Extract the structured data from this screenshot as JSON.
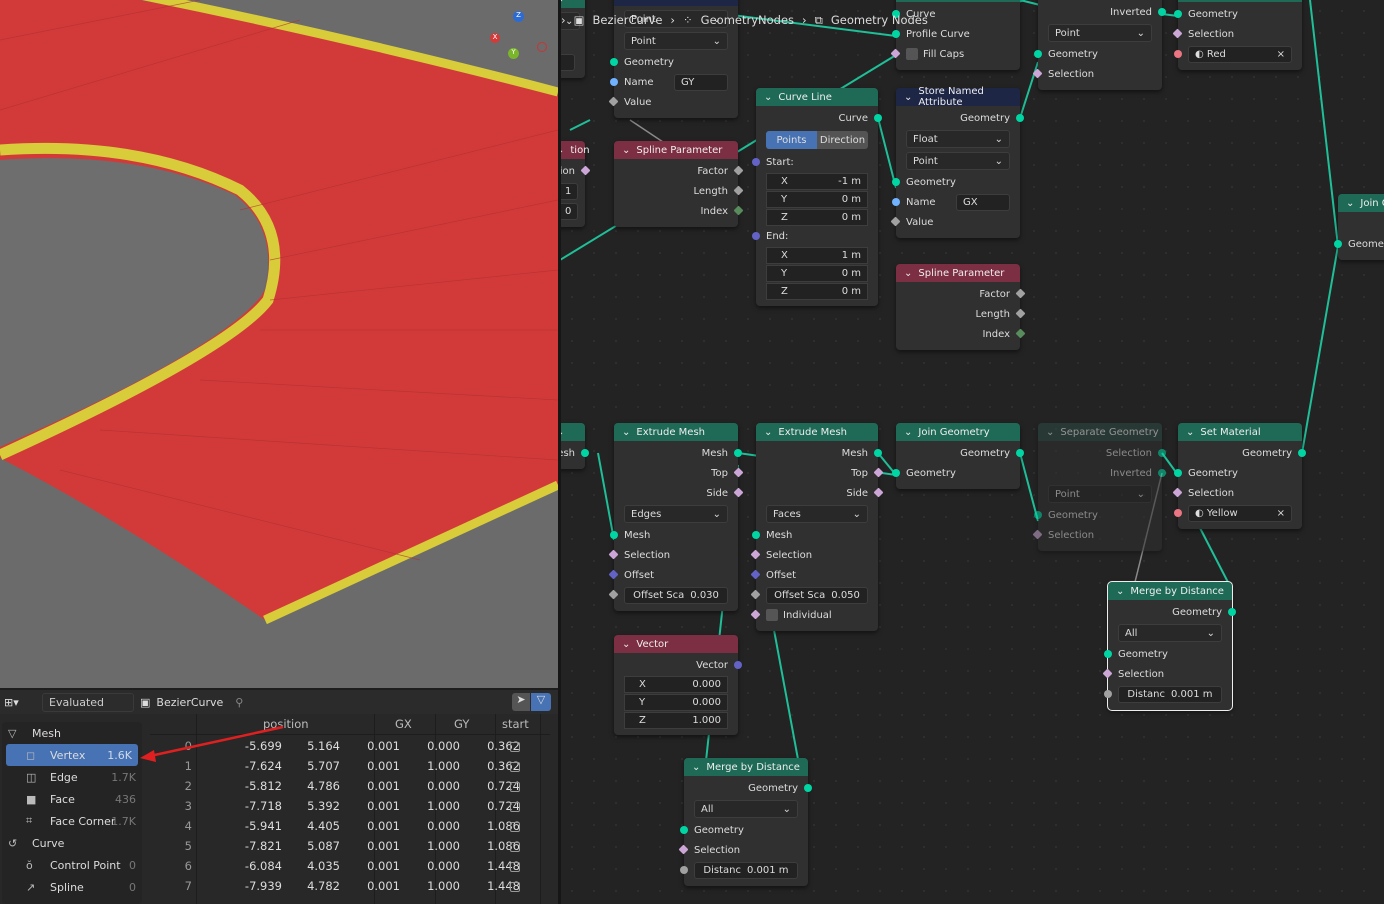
{
  "viewport": {
    "gizmo": {
      "x": "X",
      "y": "Y",
      "z": "Z"
    },
    "colors": {
      "road": "#d23a3a",
      "curb": "#d8cc3a",
      "ground": "#6b6b6b"
    }
  },
  "spreadsheet": {
    "mode": "Evaluated",
    "object": "BezierCurve",
    "domains": [
      {
        "label": "Mesh",
        "count": "",
        "icon": "mesh-icon",
        "group": true
      },
      {
        "label": "Vertex",
        "count": "1.6K",
        "icon": "vertex-icon",
        "selected": true
      },
      {
        "label": "Edge",
        "count": "1.7K",
        "icon": "edge-icon"
      },
      {
        "label": "Face",
        "count": "436",
        "icon": "face-icon"
      },
      {
        "label": "Face Corner",
        "count": "1.7K",
        "icon": "face-corner-icon"
      },
      {
        "label": "Curve",
        "count": "",
        "icon": "curve-icon",
        "group": true
      },
      {
        "label": "Control Point",
        "count": "0",
        "icon": "control-point-icon"
      },
      {
        "label": "Spline",
        "count": "0",
        "icon": "spline-icon"
      }
    ],
    "columns": [
      "position",
      "GX",
      "GY",
      "start"
    ],
    "rows": [
      [
        "0",
        "-5.699",
        "5.164",
        "0.001",
        "0.000",
        "0.362"
      ],
      [
        "1",
        "-7.624",
        "5.707",
        "0.001",
        "1.000",
        "0.362"
      ],
      [
        "2",
        "-5.812",
        "4.786",
        "0.001",
        "0.000",
        "0.724"
      ],
      [
        "3",
        "-7.718",
        "5.392",
        "0.001",
        "1.000",
        "0.724"
      ],
      [
        "4",
        "-5.941",
        "4.405",
        "0.001",
        "0.000",
        "1.086"
      ],
      [
        "5",
        "-7.821",
        "5.087",
        "0.001",
        "1.000",
        "1.086"
      ],
      [
        "6",
        "-6.084",
        "4.035",
        "0.001",
        "0.000",
        "1.448"
      ],
      [
        "7",
        "-7.939",
        "4.782",
        "0.001",
        "1.000",
        "1.448"
      ]
    ]
  },
  "breadcrumb": [
    "BezierCurve",
    "GeometryNodes",
    "Geometry Nodes"
  ],
  "node_editor": {
    "nodes": [
      {
        "id": "p1",
        "title": "",
        "kind": "geo",
        "rows": [
          {
            "t": "dd",
            "v": ""
          },
          {
            "t": "sp"
          },
          {
            "t": "fld",
            "v": ""
          }
        ]
      },
      {
        "id": "nA",
        "title": "",
        "kind": "attr",
        "rows": [
          {
            "t": "dd",
            "v": "Point"
          },
          {
            "t": "dd",
            "v": "Point"
          },
          {
            "t": "in",
            "v": "Geometry",
            "s": "geo"
          },
          {
            "t": "in",
            "v": "Name",
            "s": "str",
            "f": "GY"
          },
          {
            "t": "in",
            "v": "Value",
            "s": "float"
          }
        ]
      },
      {
        "id": "p2",
        "title": "tion",
        "kind": "input",
        "rows": [
          {
            "t": "out",
            "v": "ection",
            "s": "bool"
          },
          {
            "t": "fld",
            "v": "1"
          },
          {
            "t": "fld",
            "v": "0"
          }
        ]
      },
      {
        "id": "sp1",
        "title": "Spline Parameter",
        "kind": "input",
        "rows": [
          {
            "t": "out",
            "v": "Factor",
            "s": "float"
          },
          {
            "t": "out",
            "v": "Length",
            "s": "float"
          },
          {
            "t": "out",
            "v": "Index",
            "s": "int"
          }
        ]
      },
      {
        "id": "cl",
        "title": "Curve Line",
        "kind": "geo",
        "rows": [
          {
            "t": "out",
            "v": "Curve",
            "s": "geo"
          },
          {
            "t": "tg",
            "v": [
              "Points",
              "Direction"
            ]
          },
          {
            "t": "in",
            "v": "Start:",
            "s": "vec"
          },
          {
            "t": "vf",
            "v": "X",
            "n": "-1 m"
          },
          {
            "t": "vf",
            "v": "Y",
            "n": "0 m"
          },
          {
            "t": "vf",
            "v": "Z",
            "n": "0 m"
          },
          {
            "t": "in",
            "v": "End:",
            "s": "vec"
          },
          {
            "t": "vf",
            "v": "X",
            "n": "1 m"
          },
          {
            "t": "vf",
            "v": "Y",
            "n": "0 m"
          },
          {
            "t": "vf",
            "v": "Z",
            "n": "0 m"
          }
        ]
      },
      {
        "id": "ctm",
        "title": "",
        "kind": "geo",
        "rows": [
          {
            "t": "in",
            "v": "Curve",
            "s": "geo"
          },
          {
            "t": "in",
            "v": "Profile Curve",
            "s": "geo"
          },
          {
            "t": "chk",
            "v": "Fill Caps",
            "s": "bool"
          }
        ]
      },
      {
        "id": "sna",
        "title": "Store Named Attribute",
        "kind": "attr",
        "rows": [
          {
            "t": "out",
            "v": "Geometry",
            "s": "geo"
          },
          {
            "t": "dd",
            "v": "Float"
          },
          {
            "t": "dd",
            "v": "Point"
          },
          {
            "t": "in",
            "v": "Geometry",
            "s": "geo"
          },
          {
            "t": "in",
            "v": "Name",
            "s": "str",
            "f": "GX"
          },
          {
            "t": "in",
            "v": "Value",
            "s": "float"
          }
        ]
      },
      {
        "id": "sp2",
        "title": "Spline Parameter",
        "kind": "input",
        "rows": [
          {
            "t": "out",
            "v": "Factor",
            "s": "float"
          },
          {
            "t": "out",
            "v": "Length",
            "s": "float"
          },
          {
            "t": "out",
            "v": "Index",
            "s": "int"
          }
        ]
      },
      {
        "id": "sg1",
        "title": "",
        "kind": "geo",
        "rows": [
          {
            "t": "out",
            "v": "Inverted",
            "s": "geo"
          },
          {
            "t": "dd",
            "v": "Point"
          },
          {
            "t": "in",
            "v": "Geometry",
            "s": "geo"
          },
          {
            "t": "in",
            "v": "Selection",
            "s": "bool"
          }
        ]
      },
      {
        "id": "sm1",
        "title": "",
        "kind": "geo",
        "rows": [
          {
            "t": "in",
            "v": "Geometry",
            "s": "geo"
          },
          {
            "t": "in",
            "v": "Selection",
            "s": "bool"
          },
          {
            "t": "mat",
            "v": "Red",
            "s": "mat"
          }
        ]
      },
      {
        "id": "jg2",
        "title": "Join G",
        "kind": "geo",
        "rows": [
          {
            "t": "sp"
          },
          {
            "t": "in",
            "v": "Geomet",
            "s": "geo"
          }
        ]
      },
      {
        "id": "p3",
        "title": "",
        "kind": "geo",
        "rows": [
          {
            "t": "out",
            "v": "Mesh",
            "s": "geo"
          }
        ]
      },
      {
        "id": "em1",
        "title": "Extrude Mesh",
        "kind": "geo",
        "rows": [
          {
            "t": "out",
            "v": "Mesh",
            "s": "geo"
          },
          {
            "t": "out",
            "v": "Top",
            "s": "bool"
          },
          {
            "t": "out",
            "v": "Side",
            "s": "bool"
          },
          {
            "t": "dd",
            "v": "Edges"
          },
          {
            "t": "in",
            "v": "Mesh",
            "s": "geo"
          },
          {
            "t": "in",
            "v": "Selection",
            "s": "bool"
          },
          {
            "t": "in",
            "v": "Offset",
            "s": "vecd"
          },
          {
            "t": "nf",
            "v": "Offset Sca",
            "n": "0.030",
            "s": "float"
          }
        ]
      },
      {
        "id": "em2",
        "title": "Extrude Mesh",
        "kind": "geo",
        "rows": [
          {
            "t": "out",
            "v": "Mesh",
            "s": "geo"
          },
          {
            "t": "out",
            "v": "Top",
            "s": "bool"
          },
          {
            "t": "out",
            "v": "Side",
            "s": "bool"
          },
          {
            "t": "dd",
            "v": "Faces"
          },
          {
            "t": "in",
            "v": "Mesh",
            "s": "geo"
          },
          {
            "t": "in",
            "v": "Selection",
            "s": "bool"
          },
          {
            "t": "in",
            "v": "Offset",
            "s": "vecd"
          },
          {
            "t": "nf",
            "v": "Offset Sca",
            "n": "0.050",
            "s": "float"
          },
          {
            "t": "chk",
            "v": "Individual",
            "s": "bool"
          }
        ]
      },
      {
        "id": "jg",
        "title": "Join Geometry",
        "kind": "geo",
        "rows": [
          {
            "t": "out",
            "v": "Geometry",
            "s": "geo"
          },
          {
            "t": "in",
            "v": "Geometry",
            "s": "geo"
          }
        ]
      },
      {
        "id": "sg2",
        "title": "Separate Geometry",
        "kind": "geo",
        "muted": true,
        "rows": [
          {
            "t": "out",
            "v": "Selection",
            "s": "geo"
          },
          {
            "t": "out",
            "v": "Inverted",
            "s": "geo"
          },
          {
            "t": "dd",
            "v": "Point"
          },
          {
            "t": "in",
            "v": "Geometry",
            "s": "geo"
          },
          {
            "t": "in",
            "v": "Selection",
            "s": "bool"
          }
        ]
      },
      {
        "id": "sm2",
        "title": "Set Material",
        "kind": "geo",
        "rows": [
          {
            "t": "out",
            "v": "Geometry",
            "s": "geo"
          },
          {
            "t": "in",
            "v": "Geometry",
            "s": "geo"
          },
          {
            "t": "in",
            "v": "Selection",
            "s": "bool"
          },
          {
            "t": "mat",
            "v": "Yellow",
            "s": "mat"
          }
        ]
      },
      {
        "id": "mbd2",
        "title": "Merge by Distance",
        "kind": "geo",
        "selected": true,
        "rows": [
          {
            "t": "out",
            "v": "Geometry",
            "s": "geo"
          },
          {
            "t": "dd",
            "v": "All"
          },
          {
            "t": "in",
            "v": "Geometry",
            "s": "geo"
          },
          {
            "t": "in",
            "v": "Selection",
            "s": "bool"
          },
          {
            "t": "nf",
            "v": "Distanc",
            "n": "0.001 m",
            "s": "floatc"
          }
        ]
      },
      {
        "id": "vec",
        "title": "Vector",
        "kind": "input",
        "rows": [
          {
            "t": "out",
            "v": "Vector",
            "s": "vec"
          },
          {
            "t": "vf",
            "v": "X",
            "n": "0.000"
          },
          {
            "t": "vf",
            "v": "Y",
            "n": "0.000"
          },
          {
            "t": "vf",
            "v": "Z",
            "n": "1.000"
          }
        ]
      },
      {
        "id": "mbd1",
        "title": "Merge by Distance",
        "kind": "geo",
        "rows": [
          {
            "t": "out",
            "v": "Geometry",
            "s": "geo"
          },
          {
            "t": "dd",
            "v": "All"
          },
          {
            "t": "in",
            "v": "Geometry",
            "s": "geo"
          },
          {
            "t": "in",
            "v": "Selection",
            "s": "bool"
          },
          {
            "t": "nf",
            "v": "Distanc",
            "n": "0.001 m",
            "s": "floatc"
          }
        ]
      }
    ]
  },
  "colors": {
    "geo_header": "#1e6a57",
    "input_header": "#7c2e42",
    "attr_header": "#1e2646",
    "accent": "#4772b3",
    "link": "#1fbf98"
  }
}
